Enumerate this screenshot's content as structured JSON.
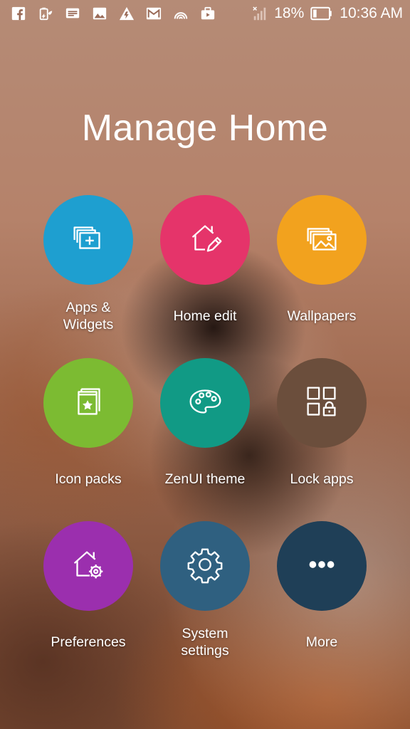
{
  "status_bar": {
    "left_icons": [
      "facebook-icon",
      "battery-saver-icon",
      "message-icon",
      "image-icon",
      "network-alert-icon",
      "gmail-icon",
      "wireless-icon",
      "briefcase-icon"
    ],
    "battery_percent": "18%",
    "time": "10:36 AM"
  },
  "title": "Manage Home",
  "tiles": [
    {
      "label": "Apps &\nWidgets",
      "icon": "apps-widgets-icon",
      "color": "#1e9fd0"
    },
    {
      "label": "Home edit",
      "icon": "home-edit-icon",
      "color": "#e5346a"
    },
    {
      "label": "Wallpapers",
      "icon": "wallpapers-icon",
      "color": "#f2a21e"
    },
    {
      "label": "Icon packs",
      "icon": "icon-packs-icon",
      "color": "#7cbb32"
    },
    {
      "label": "ZenUI theme",
      "icon": "palette-icon",
      "color": "#119a85"
    },
    {
      "label": "Lock apps",
      "icon": "lock-apps-icon",
      "color": "#6b4e3c"
    },
    {
      "label": "Preferences",
      "icon": "preferences-icon",
      "color": "#9b2fae"
    },
    {
      "label": "System\nsettings",
      "icon": "gear-icon",
      "color": "#2f6080"
    },
    {
      "label": "More",
      "icon": "more-icon",
      "color": "#1f3f57"
    }
  ]
}
